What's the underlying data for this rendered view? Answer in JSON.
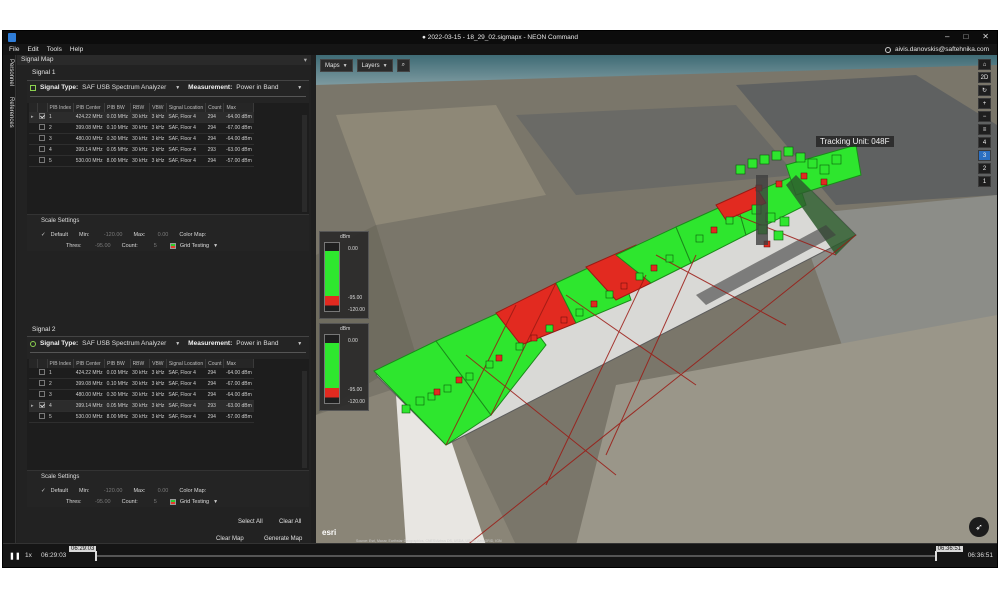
{
  "window": {
    "title": "● 2022-03-15 - 18_29_02.sigmapx - NEON Command",
    "controls": [
      "–",
      "□",
      "✕"
    ]
  },
  "menu": {
    "items": [
      "File",
      "Edit",
      "Tools",
      "Help"
    ],
    "user": "aivis.danovskis@saftehnika.com"
  },
  "side_tabs": [
    "Personnel",
    "References"
  ],
  "panel": {
    "title": "Signal Map"
  },
  "signals": [
    {
      "label": "Signal 1",
      "type_label": "Signal Type:",
      "type_value": "SAF USB Spectrum Analyzer",
      "measurement_label": "Measurement:",
      "measurement_value": "Power in Band",
      "columns": [
        "PIB Index",
        "PIB Center",
        "PIB BW",
        "RBW",
        "VBW",
        "Signal Location",
        "Count",
        "Max"
      ],
      "rows": [
        {
          "checked": true,
          "index": "1",
          "center": "424.22 MHz",
          "bw": "0.03 MHz",
          "rbw": "30 kHz",
          "vbw": "3 kHz",
          "loc": "SAF, Floor 4",
          "count": "294",
          "max": "-64.00 dBm"
        },
        {
          "checked": false,
          "index": "2",
          "center": "399.08 MHz",
          "bw": "0.10 MHz",
          "rbw": "30 kHz",
          "vbw": "3 kHz",
          "loc": "SAF, Floor 4",
          "count": "294",
          "max": "-67.00 dBm"
        },
        {
          "checked": false,
          "index": "3",
          "center": "480.00 MHz",
          "bw": "0.30 MHz",
          "rbw": "30 kHz",
          "vbw": "3 kHz",
          "loc": "SAF, Floor 4",
          "count": "294",
          "max": "-64.00 dBm"
        },
        {
          "checked": false,
          "index": "4",
          "center": "399.14 MHz",
          "bw": "0.05 MHz",
          "rbw": "30 kHz",
          "vbw": "3 kHz",
          "loc": "SAF, Floor 4",
          "count": "293",
          "max": "-63.00 dBm"
        },
        {
          "checked": false,
          "index": "5",
          "center": "530.00 MHz",
          "bw": "8.00 MHz",
          "rbw": "30 kHz",
          "vbw": "3 kHz",
          "loc": "SAF, Floor 4",
          "count": "294",
          "max": "-57.00 dBm"
        }
      ],
      "scale": {
        "title": "Scale Settings",
        "default_label": "Default",
        "min_label": "Min:",
        "min_value": "-120.00",
        "max_label": "Max:",
        "max_value": "0.00",
        "colormap_label": "Color Map:",
        "thres_label": "Thres:",
        "thres_value": "-95.00",
        "count_label": "Count:",
        "count_value": "5",
        "colormap_value": "Grid Testing"
      }
    },
    {
      "label": "Signal 2",
      "type_label": "Signal Type:",
      "type_value": "SAF USB Spectrum Analyzer",
      "measurement_label": "Measurement:",
      "measurement_value": "Power in Band",
      "columns": [
        "PIB Index",
        "PIB Center",
        "PIB BW",
        "RBW",
        "VBW",
        "Signal Location",
        "Count",
        "Max"
      ],
      "rows": [
        {
          "checked": false,
          "index": "1",
          "center": "424.22 MHz",
          "bw": "0.03 MHz",
          "rbw": "30 kHz",
          "vbw": "3 kHz",
          "loc": "SAF, Floor 4",
          "count": "294",
          "max": "-64.00 dBm"
        },
        {
          "checked": false,
          "index": "2",
          "center": "399.08 MHz",
          "bw": "0.10 MHz",
          "rbw": "30 kHz",
          "vbw": "3 kHz",
          "loc": "SAF, Floor 4",
          "count": "294",
          "max": "-67.00 dBm"
        },
        {
          "checked": false,
          "index": "3",
          "center": "480.00 MHz",
          "bw": "0.30 MHz",
          "rbw": "30 kHz",
          "vbw": "3 kHz",
          "loc": "SAF, Floor 4",
          "count": "294",
          "max": "-64.00 dBm"
        },
        {
          "checked": true,
          "index": "4",
          "center": "399.14 MHz",
          "bw": "0.05 MHz",
          "rbw": "30 kHz",
          "vbw": "3 kHz",
          "loc": "SAF, Floor 4",
          "count": "293",
          "max": "-63.00 dBm"
        },
        {
          "checked": false,
          "index": "5",
          "center": "530.00 MHz",
          "bw": "8.00 MHz",
          "rbw": "30 kHz",
          "vbw": "3 kHz",
          "loc": "SAF, Floor 4",
          "count": "294",
          "max": "-57.00 dBm"
        }
      ],
      "scale": {
        "title": "Scale Settings",
        "default_label": "Default",
        "min_label": "Min:",
        "min_value": "-120.00",
        "max_label": "Max:",
        "max_value": "0.00",
        "colormap_label": "Color Map:",
        "thres_label": "Thres:",
        "thres_value": "-95.00",
        "count_label": "Count:",
        "count_value": "5",
        "colormap_value": "Grid Testing"
      }
    }
  ],
  "buttons": {
    "select_all": "Select All",
    "clear_all": "Clear All",
    "clear_map": "Clear Map",
    "generate_map": "Generate Map"
  },
  "map": {
    "maps_btn": "Maps",
    "layers_btn": "Layers",
    "tracking": "Tracking Unit: 048F",
    "view_mode": "2D",
    "floors": [
      "4",
      "3",
      "2",
      "1"
    ],
    "active_floor": "3",
    "legend_unit": "dBm",
    "legend_labels": [
      "0.00",
      "-95.00",
      "-120.00"
    ],
    "esri": "esri",
    "attribution": "Source: Esri, Maxar, Earthstar Geographics, CNES/Airbus DS, USDA, USGS, AeroGRID, IGN"
  },
  "timeline": {
    "speed": "1x",
    "start": "06:29:03",
    "cursor_start": "06:29:03",
    "cursor_end": "06:36:51",
    "end": "06:36:51"
  },
  "colors": {
    "good": "#2ee62e",
    "bad": "#e22a20",
    "accent": "#2a6fc2"
  }
}
